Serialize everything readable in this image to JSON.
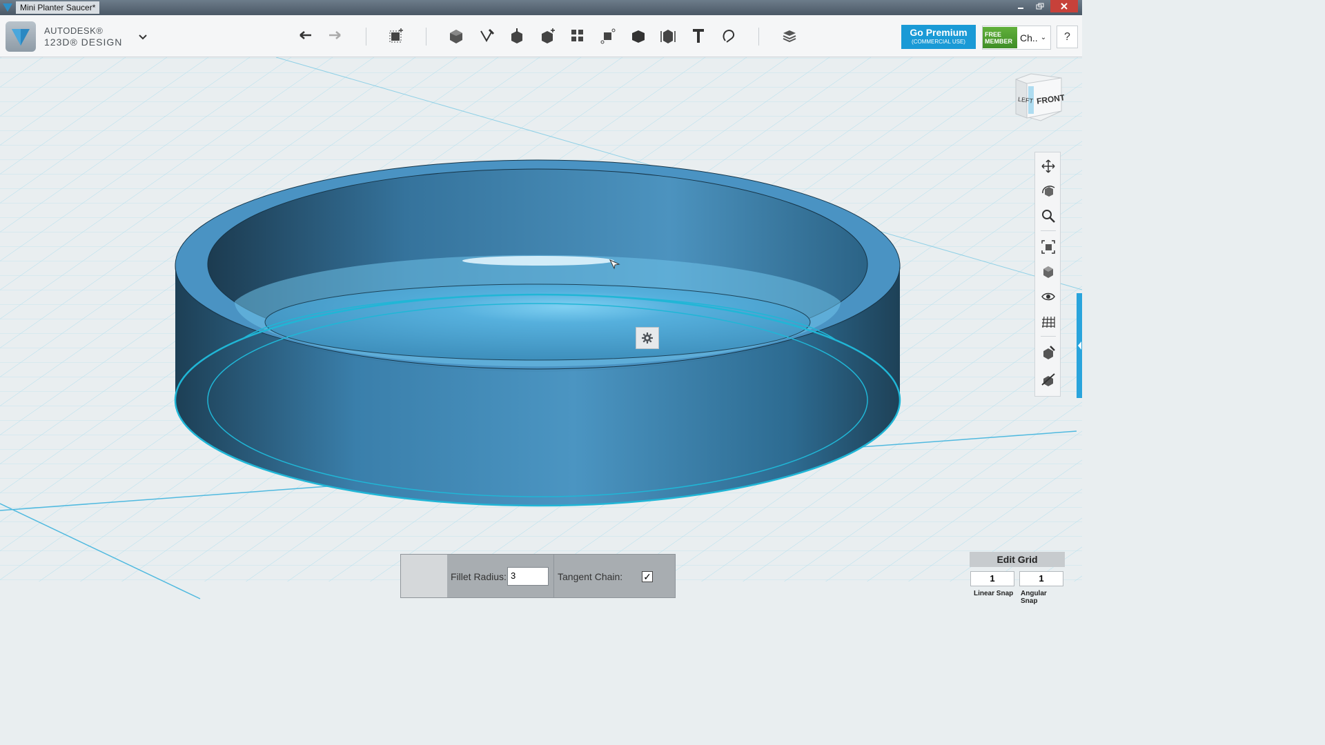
{
  "window": {
    "title": "Mini Planter Saucer*",
    "controls": [
      "minimize",
      "restore",
      "close"
    ]
  },
  "brand": {
    "line1": "AUTODESK®",
    "line2": "123D® DESIGN"
  },
  "toolbar": {
    "tools": [
      "undo-icon",
      "redo-icon",
      "transform-icon",
      "primitives-icon",
      "sketch-icon",
      "construct-icon",
      "modify-icon",
      "pattern-icon",
      "group-icon",
      "combine-icon",
      "measure-icon",
      "text-icon",
      "snap-icon",
      "materials-icon"
    ]
  },
  "premium": {
    "title": "Go Premium",
    "subtitle": "(COMMERCIAL USE)"
  },
  "member": {
    "badge_line1": "FREE",
    "badge_line2": "MEMBER",
    "user": "Ch..",
    "chevron": "⌄"
  },
  "help": {
    "label": "?"
  },
  "viewcube": {
    "left_face": "LEFT",
    "front_face": "FRONT"
  },
  "navbar": {
    "tools": [
      "pan-icon",
      "orbit-icon",
      "zoom-icon",
      "fit-icon",
      "views-icon",
      "visibility-icon",
      "grid-icon",
      "material-icon",
      "snap-tool-icon"
    ]
  },
  "fillet": {
    "radius_label": "Fillet Radius:",
    "radius_value": "3",
    "tangent_label": "Tangent Chain:",
    "tangent_checked": "✓"
  },
  "grid": {
    "title": "Edit Grid",
    "linear_value": "1",
    "angular_value": "1",
    "linear_label": "Linear Snap",
    "angular_label": "Angular Snap"
  },
  "colors": {
    "accent": "#1a9ad6",
    "model": "#4a93c0",
    "grid": "#8fd0e6",
    "viewport_bg": "#e9eef0"
  }
}
